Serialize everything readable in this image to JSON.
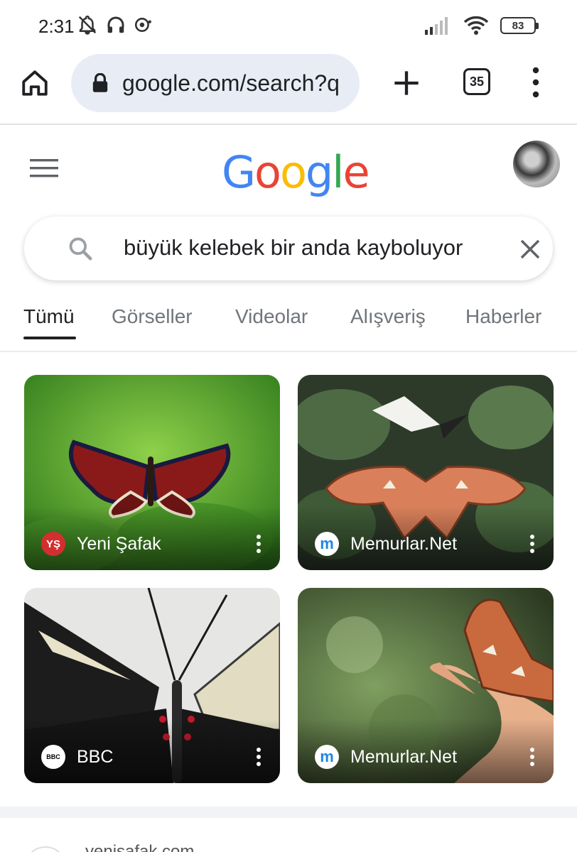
{
  "status_bar": {
    "time": "2:31",
    "battery": "83"
  },
  "browser": {
    "url": "google.com/search?q",
    "tab_count": "35"
  },
  "search": {
    "query": "büyük kelebek bir anda kayboluyor"
  },
  "tabs": [
    {
      "label": "Tümü",
      "active": true
    },
    {
      "label": "Görseller",
      "active": false
    },
    {
      "label": "Videolar",
      "active": false
    },
    {
      "label": "Alışveriş",
      "active": false
    },
    {
      "label": "Haberler",
      "active": false
    }
  ],
  "images": [
    {
      "source": "Yeni Şafak",
      "favicon_text": "YŞ",
      "favicon_color": "#d32f2f"
    },
    {
      "source": "Memurlar.Net",
      "favicon_text": "m",
      "favicon_color": "#1e88e5"
    },
    {
      "source": "BBC",
      "favicon_text": "BBC",
      "favicon_color": "#000000"
    },
    {
      "source": "Memurlar.Net",
      "favicon_text": "m",
      "favicon_color": "#1e88e5"
    }
  ],
  "next_result": "yenisafak.com"
}
